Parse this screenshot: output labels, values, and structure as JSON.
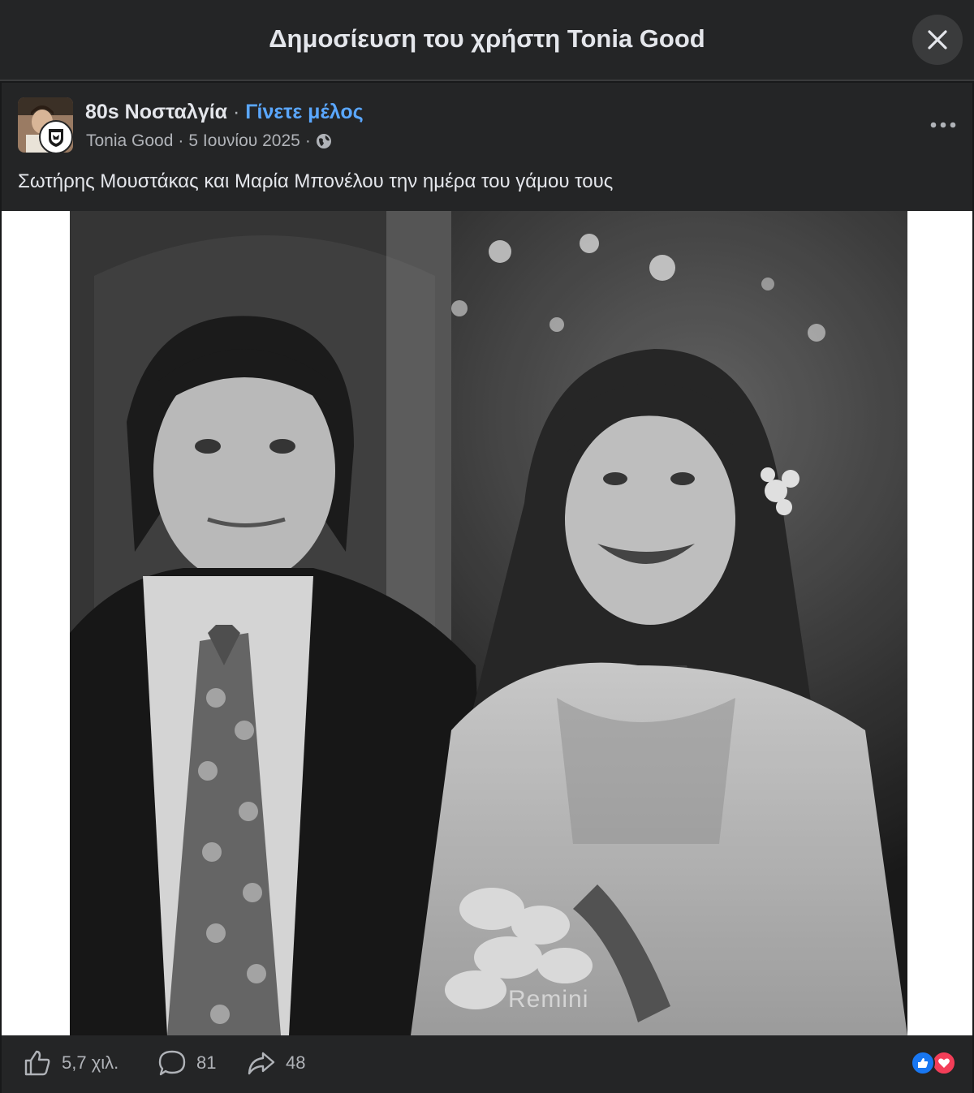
{
  "header": {
    "title": "Δημοσίευση του χρήστη Tonia Good"
  },
  "post": {
    "group_name": "80s Νοσταλγία",
    "separator": "·",
    "join_label": "Γίνετε μέλος",
    "author": "Tonia Good",
    "date": "5 Ιουνίου 2025",
    "caption": "Σωτήρης Μουστάκας και Μαρία Μπονέλου την ημέρα του γάμου τους",
    "watermark": "Remini"
  },
  "actions": {
    "likes": "5,7 χιλ.",
    "comments": "81",
    "shares": "48"
  },
  "colors": {
    "background": "#18191a",
    "card": "#242526",
    "link": "#5aa7ff",
    "like_blue": "#1877f2",
    "love_red": "#f33e58"
  }
}
